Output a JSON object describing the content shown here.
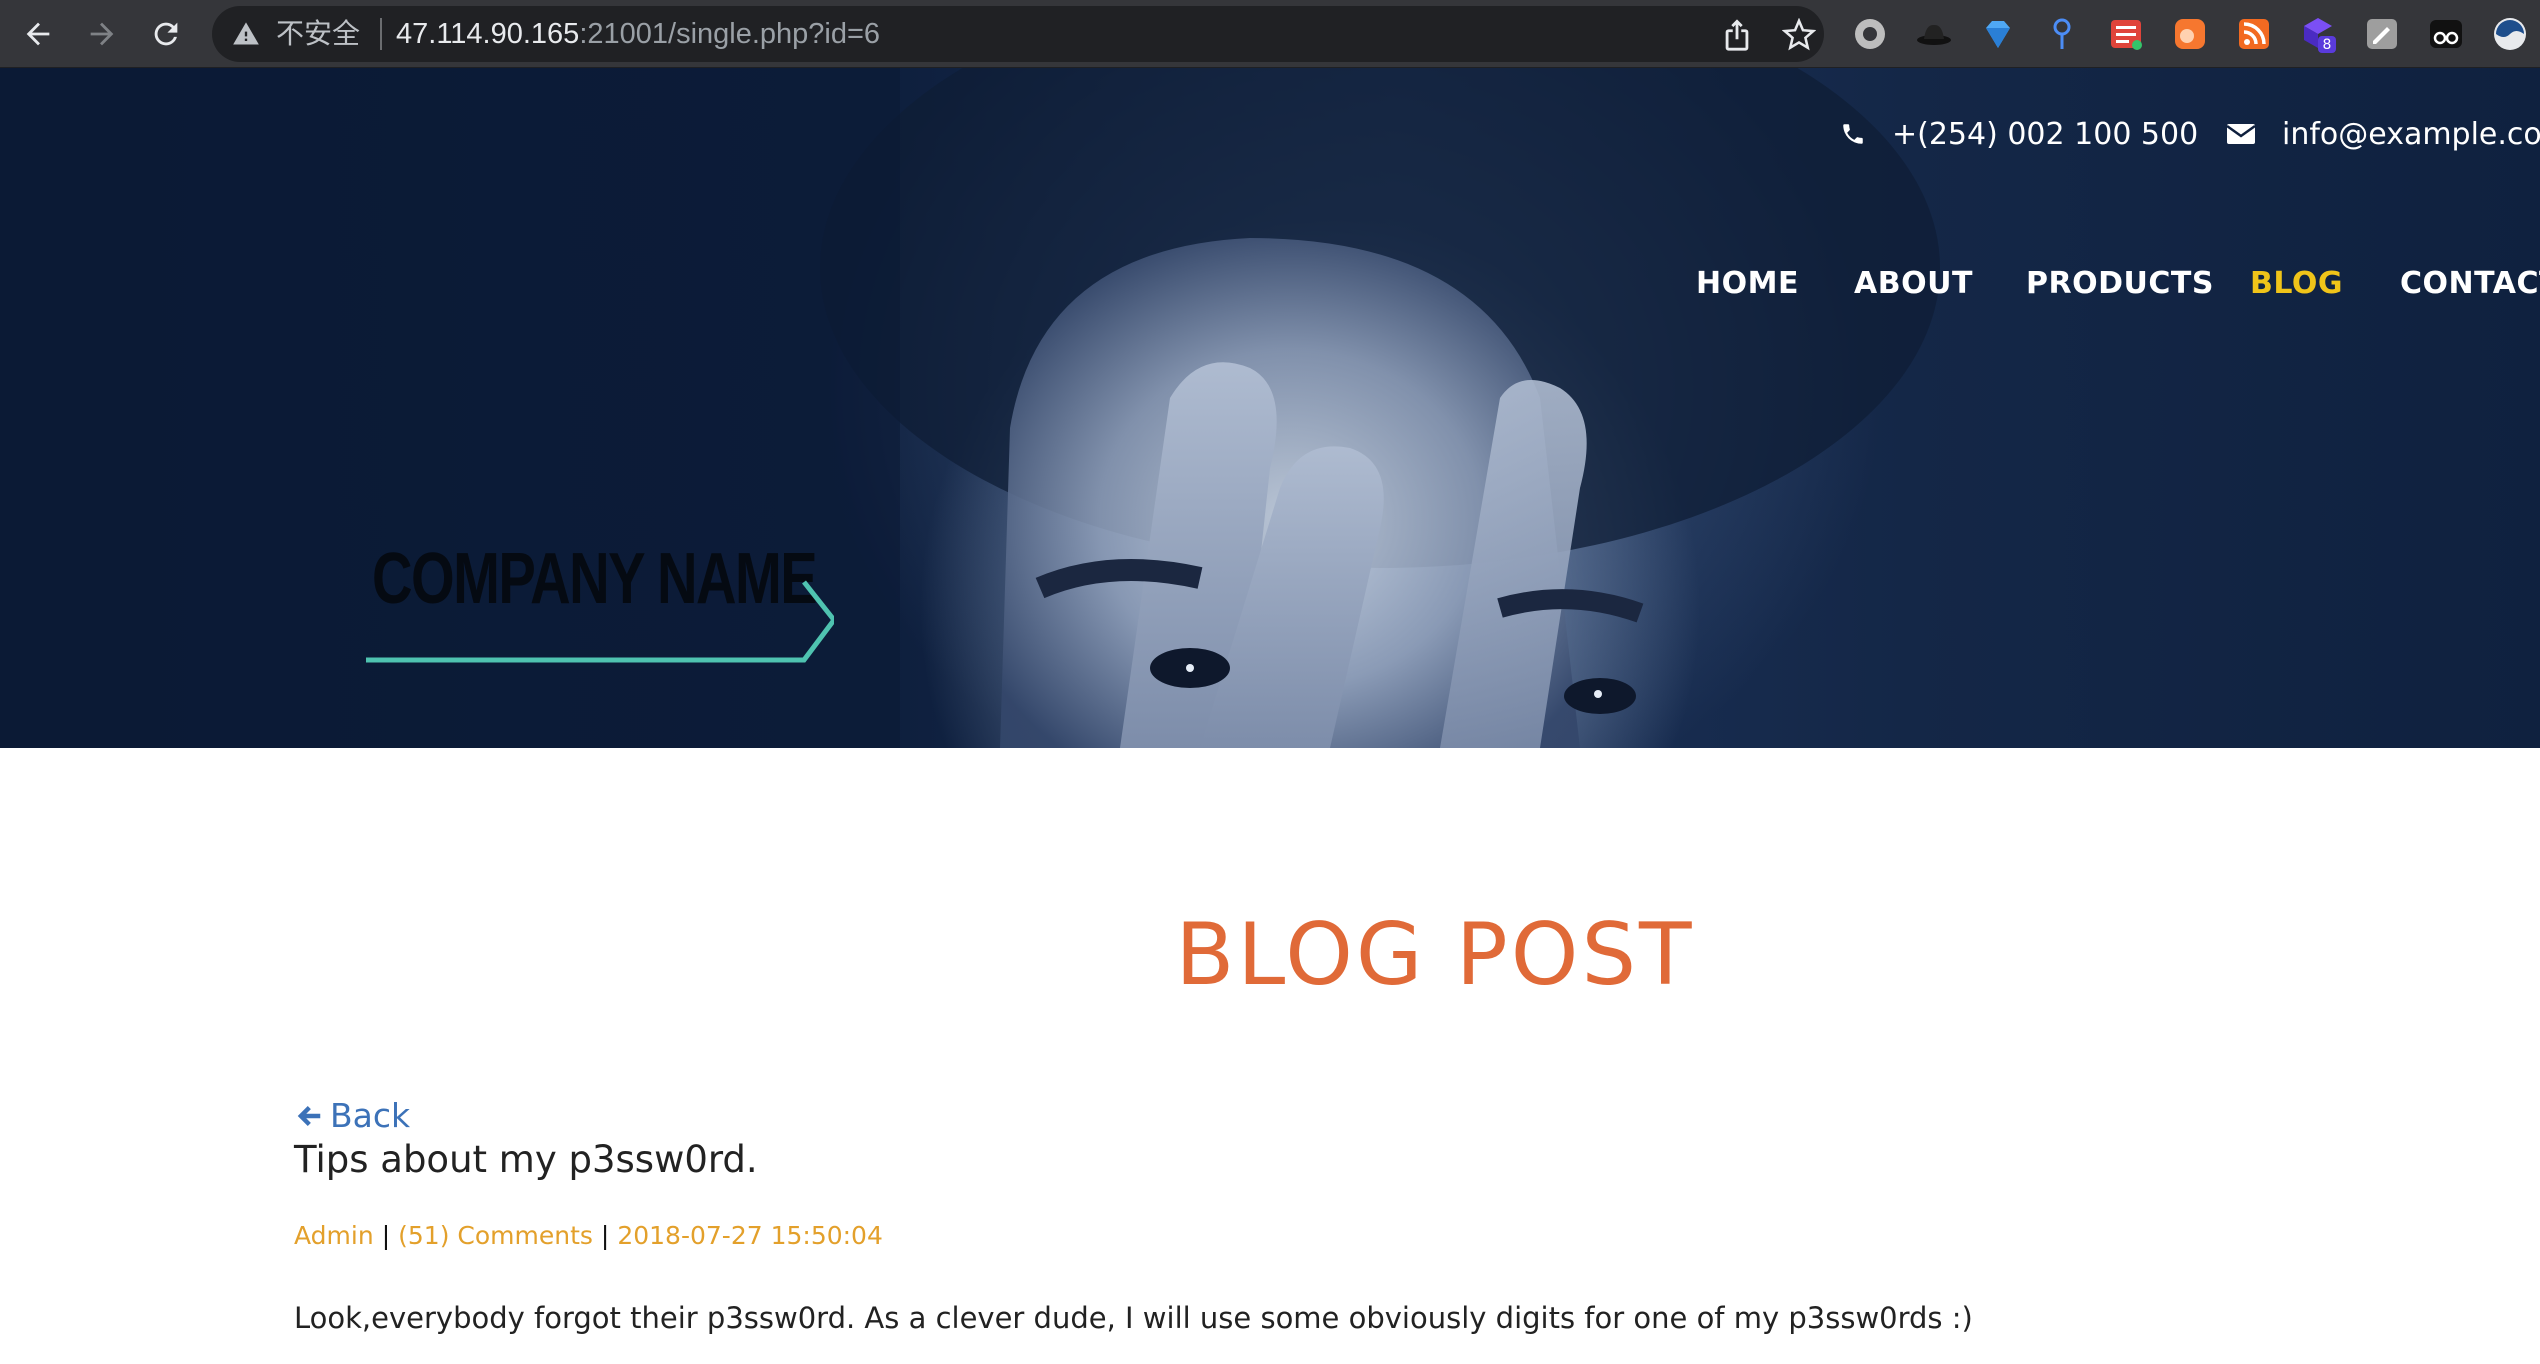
{
  "browser": {
    "security_label": "不安全",
    "url_host": "47.114.90.165",
    "url_rest": ":21001/single.php?id=6",
    "extensions_badge": "8",
    "icons": [
      "back-arrow-icon",
      "forward-arrow-icon",
      "reload-icon",
      "warning-icon",
      "share-icon",
      "star-icon"
    ]
  },
  "header": {
    "phone": "+(254) 002 100 500",
    "email": "info@example.com",
    "nav": [
      {
        "label": "HOME"
      },
      {
        "label": "ABOUT"
      },
      {
        "label": "PRODUCTS"
      },
      {
        "label": "BLOG"
      },
      {
        "label": "CONTACT"
      }
    ],
    "active_nav": "BLOG",
    "logo_text": "COMPANY NAME",
    "colors": {
      "active_nav": "#f0c419",
      "logo_accent": "#4fc3b0"
    }
  },
  "content": {
    "page_title": "BLOG POST",
    "back_label": "Back",
    "post_title": "Tips about my p3ssw0rd.",
    "meta": {
      "author": "Admin",
      "separator": "|",
      "comments": "(51) Comments",
      "date": "2018-07-27 15:50:04"
    },
    "body": "Look,everybody forgot their p3ssw0rd. As a clever dude, I will use some obviously digits for one of my p3ssw0rds :)",
    "colors": {
      "title": "#e06a38",
      "link": "#3c72b8",
      "meta": "#e3a02b"
    }
  }
}
